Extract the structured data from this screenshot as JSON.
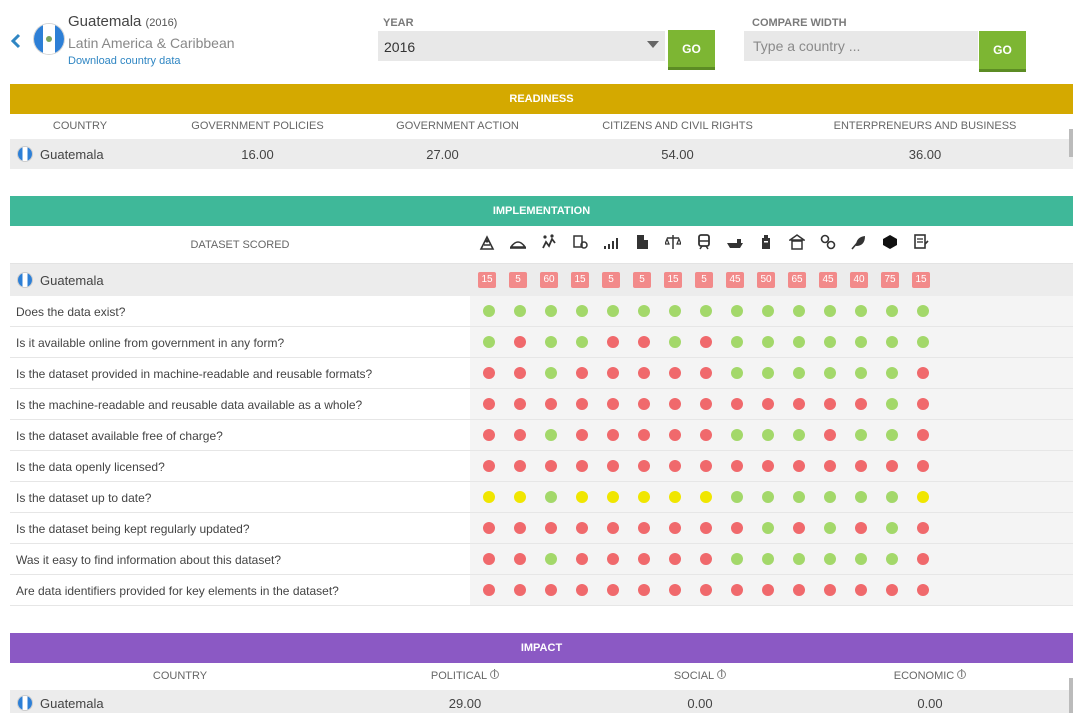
{
  "header": {
    "country": "Guatemala",
    "year_tag": "(2016)",
    "region": "Latin America & Caribbean",
    "download_link": "Download country data",
    "year_label": "YEAR",
    "year_value": "2016",
    "go_label": "GO",
    "compare_label": "COMPARE WIDTH",
    "compare_placeholder": "Type a country ..."
  },
  "readiness": {
    "title": "READINESS",
    "columns": [
      "COUNTRY",
      "GOVERNMENT POLICIES",
      "GOVERNMENT ACTION",
      "CITIZENS AND CIVIL RIGHTS",
      "ENTERPRENEURS AND BUSINESS"
    ],
    "row": {
      "country": "Guatemala",
      "values": [
        "16.00",
        "27.00",
        "54.00",
        "36.00"
      ]
    }
  },
  "implementation": {
    "title": "IMPLEMENTATION",
    "dataset_label": "DATASET SCORED",
    "icons": [
      "map-icon",
      "land-icon",
      "spending-icon",
      "company-icon",
      "statistics-icon",
      "building-icon",
      "legislation-icon",
      "transport-icon",
      "trade-icon",
      "budget-icon",
      "government-icon",
      "contracts-icon",
      "environment-icon",
      "crime-icon",
      "education-icon"
    ],
    "country": "Guatemala",
    "scores": [
      "15",
      "5",
      "60",
      "15",
      "5",
      "5",
      "15",
      "5",
      "45",
      "50",
      "65",
      "45",
      "40",
      "75",
      "15"
    ],
    "questions": [
      {
        "text": "Does the data exist?",
        "cells": "GGGGGGGGGGGGGGG"
      },
      {
        "text": "Is it available online from government in any form?",
        "cells": "GRGGRRGRGGGGGGG"
      },
      {
        "text": "Is the dataset provided in machine-readable and reusable formats?",
        "cells": "RRGRRRRRGGGGGGR"
      },
      {
        "text": "Is the machine-readable and reusable data available as a whole?",
        "cells": "RRRRRRRRRRRRRGR"
      },
      {
        "text": "Is the dataset available free of charge?",
        "cells": "RRGRRRRRGGGRGGR"
      },
      {
        "text": "Is the data openly licensed?",
        "cells": "RRRRRRRRRRRRRRR"
      },
      {
        "text": "Is the dataset up to date?",
        "cells": "YYGYYYYYGGGGGGY"
      },
      {
        "text": "Is the dataset being kept regularly updated?",
        "cells": "RRRRRRRRRGRGRGR"
      },
      {
        "text": "Was it easy to find information about this dataset?",
        "cells": "RRGRRRRRGGGGGGR"
      },
      {
        "text": "Are data identifiers provided for key elements in the dataset?",
        "cells": "RRRRRRRRRRRRRRR"
      }
    ]
  },
  "impact": {
    "title": "IMPACT",
    "columns": [
      "COUNTRY",
      "POLITICAL",
      "SOCIAL",
      "ECONOMIC"
    ],
    "info_glyph": "i",
    "row": {
      "country": "Guatemala",
      "values": [
        "29.00",
        "0.00",
        "0.00"
      ]
    }
  },
  "colors": {
    "readiness": "#d4a900",
    "implementation": "#3fb899",
    "impact": "#8b59c4",
    "go": "#7db633",
    "red": "#f0696c",
    "green": "#a3d86a",
    "yellow": "#f0e600"
  }
}
